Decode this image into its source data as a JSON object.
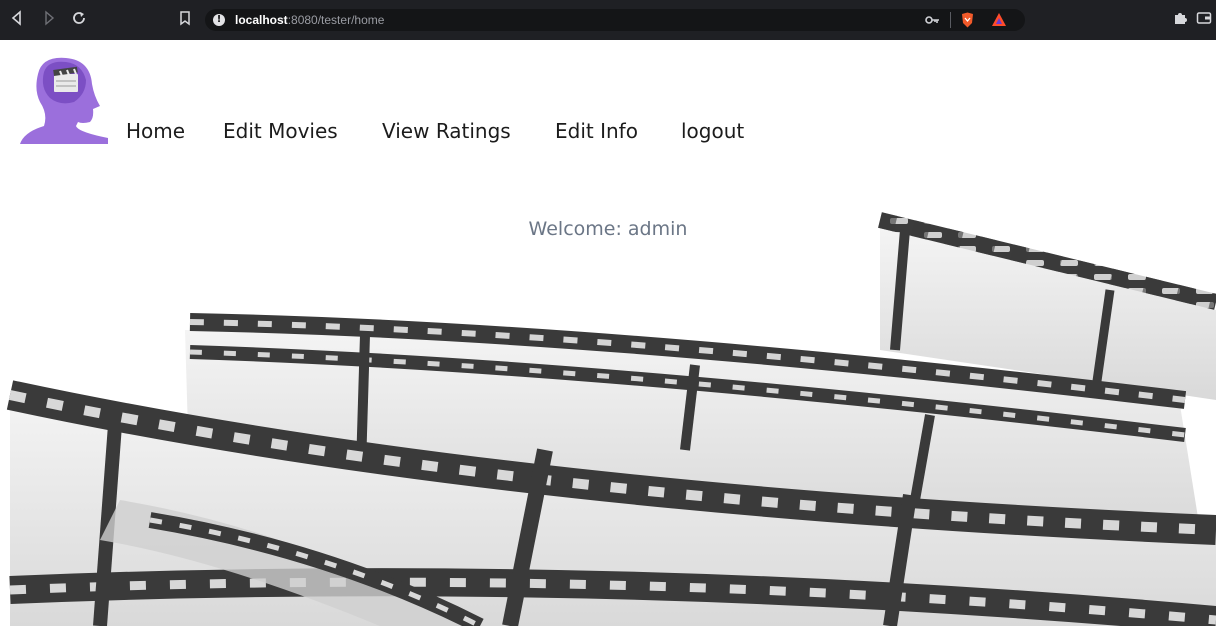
{
  "browser": {
    "url_host": "localhost",
    "url_rest": ":8080/tester/home",
    "icons": {
      "back": "back-icon",
      "forward": "forward-icon",
      "reload": "reload-icon",
      "bookmark": "bookmark-icon",
      "site_info": "info-icon",
      "password_key": "key-icon",
      "brave_shields": "brave-shield-icon",
      "brave_rewards": "brave-rewards-icon",
      "extensions": "puzzle-icon",
      "wallet": "wallet-icon"
    }
  },
  "header": {
    "logo": "movie-head-logo",
    "nav": [
      {
        "label": "Home"
      },
      {
        "label": "Edit Movies"
      },
      {
        "label": "View Ratings"
      },
      {
        "label": "Edit Info"
      },
      {
        "label": "logout"
      }
    ]
  },
  "main": {
    "welcome": "Welcome: admin",
    "background": "film-reel-image"
  },
  "colors": {
    "chrome_bg": "#1f2024",
    "logo_purple": "#9b6fdc",
    "welcome_text": "#6b7686",
    "nav_text": "#1c1c1c"
  }
}
